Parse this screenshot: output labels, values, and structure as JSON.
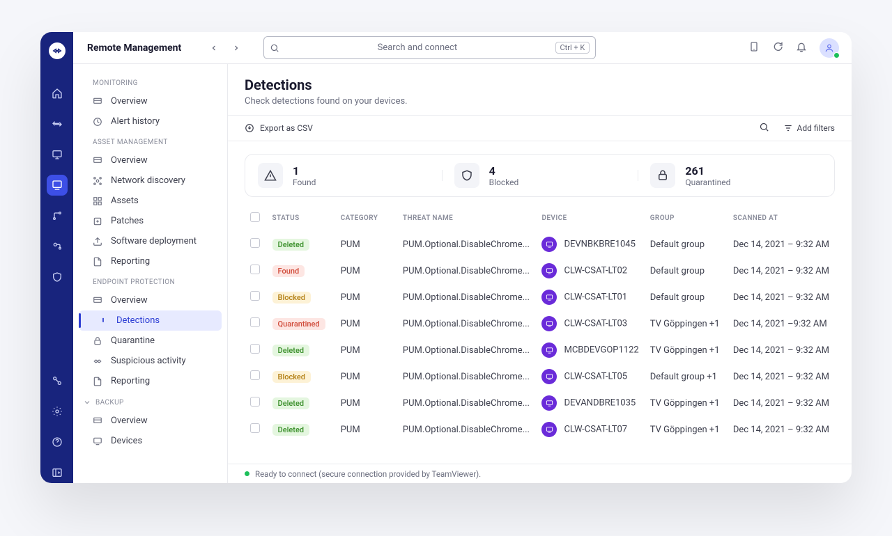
{
  "header": {
    "title": "Remote Management",
    "search_placeholder": "Search and connect",
    "shortcut": "Ctrl + K"
  },
  "sidebar": {
    "sections": [
      {
        "heading": "MONITORING",
        "items": [
          {
            "label": "Overview"
          },
          {
            "label": "Alert history"
          }
        ]
      },
      {
        "heading": "ASSET MANAGEMENT",
        "items": [
          {
            "label": "Overview"
          },
          {
            "label": "Network discovery"
          },
          {
            "label": "Assets"
          },
          {
            "label": "Patches"
          },
          {
            "label": "Software deployment"
          },
          {
            "label": "Reporting"
          }
        ]
      },
      {
        "heading": "ENDPOINT PROTECTION",
        "items": [
          {
            "label": "Overview"
          },
          {
            "label": "Detections"
          },
          {
            "label": "Quarantine"
          },
          {
            "label": "Suspicious activity"
          },
          {
            "label": "Reporting"
          }
        ]
      },
      {
        "heading": "BACKUP",
        "items": [
          {
            "label": "Overview"
          },
          {
            "label": "Devices"
          }
        ]
      }
    ]
  },
  "page": {
    "title": "Detections",
    "subtitle": "Check detections found on your devices."
  },
  "toolbar": {
    "export_label": "Export as CSV",
    "filters_label": "Add filters"
  },
  "stats": [
    {
      "value": "1",
      "label": "Found"
    },
    {
      "value": "4",
      "label": "Blocked"
    },
    {
      "value": "261",
      "label": "Quarantined"
    }
  ],
  "table": {
    "columns": [
      "STATUS",
      "CATEGORY",
      "THREAT NAME",
      "DEVICE",
      "GROUP",
      "SCANNED AT"
    ],
    "rows": [
      {
        "status": "Deleted",
        "status_class": "b-deleted",
        "category": "PUM",
        "threat": "PUM.Optional.DisableChrome...",
        "device": "DEVNBKBRE1045",
        "group": "Default group",
        "scanned": "Dec 14, 2021 – 9:32 AM"
      },
      {
        "status": "Found",
        "status_class": "b-found",
        "category": "PUM",
        "threat": "PUM.Optional.DisableChrome...",
        "device": "CLW-CSAT-LT02",
        "group": "Default group",
        "scanned": "Dec 14, 2021 – 9:32 AM"
      },
      {
        "status": "Blocked",
        "status_class": "b-blocked",
        "category": "PUM",
        "threat": "PUM.Optional.DisableChrome...",
        "device": "CLW-CSAT-LT01",
        "group": "Default group",
        "scanned": "Dec 14, 2021 – 9:32 AM"
      },
      {
        "status": "Quarantined",
        "status_class": "b-quarantined",
        "category": "PUM",
        "threat": "PUM.Optional.DisableChrome...",
        "device": "CLW-CSAT-LT03",
        "group": "TV Göppingen +1",
        "scanned": "Dec 14, 2021 –9:32 AM"
      },
      {
        "status": "Deleted",
        "status_class": "b-deleted",
        "category": "PUM",
        "threat": "PUM.Optional.DisableChrome...",
        "device": "MCBDEVGOP1122",
        "group": "TV Göppingen +1",
        "scanned": "Dec 14, 2021 – 9:32 AM"
      },
      {
        "status": "Blocked",
        "status_class": "b-blocked",
        "category": "PUM",
        "threat": "PUM.Optional.DisableChrome...",
        "device": "CLW-CSAT-LT05",
        "group": "Default group +1",
        "scanned": "Dec 14, 2021 – 9:32 AM"
      },
      {
        "status": "Deleted",
        "status_class": "b-deleted",
        "category": "PUM",
        "threat": "PUM.Optional.DisableChrome...",
        "device": "DEVANDBRE1035",
        "group": "TV Göppingen +1",
        "scanned": "Dec 14, 2021 – 9:32 AM"
      },
      {
        "status": "Deleted",
        "status_class": "b-deleted",
        "category": "PUM",
        "threat": "PUM.Optional.DisableChrome...",
        "device": "CLW-CSAT-LT07",
        "group": "TV Göppingen +1",
        "scanned": "Dec 14, 2021 – 9:32 AM"
      }
    ]
  },
  "footer": {
    "status": "Ready to connect (secure connection provided by TeamViewer)."
  }
}
